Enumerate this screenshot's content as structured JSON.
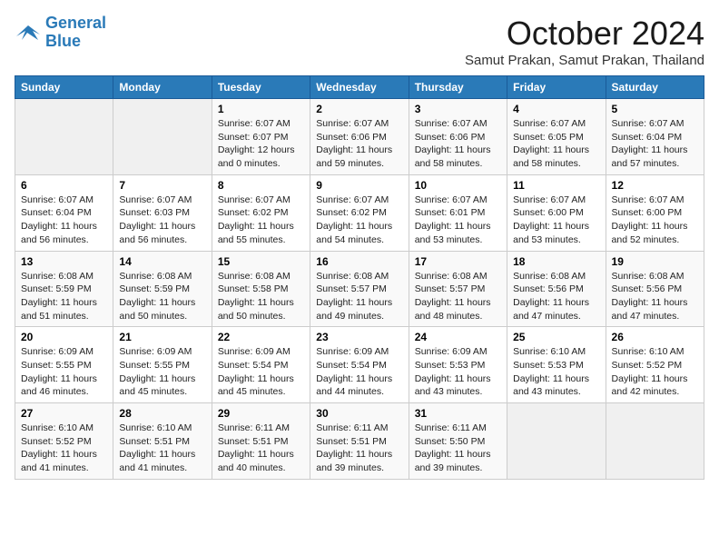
{
  "logo": {
    "line1": "General",
    "line2": "Blue"
  },
  "title": "October 2024",
  "location": "Samut Prakan, Samut Prakan, Thailand",
  "weekdays": [
    "Sunday",
    "Monday",
    "Tuesday",
    "Wednesday",
    "Thursday",
    "Friday",
    "Saturday"
  ],
  "weeks": [
    [
      {
        "day": "",
        "info": ""
      },
      {
        "day": "",
        "info": ""
      },
      {
        "day": "1",
        "info": "Sunrise: 6:07 AM\nSunset: 6:07 PM\nDaylight: 12 hours\nand 0 minutes."
      },
      {
        "day": "2",
        "info": "Sunrise: 6:07 AM\nSunset: 6:06 PM\nDaylight: 11 hours\nand 59 minutes."
      },
      {
        "day": "3",
        "info": "Sunrise: 6:07 AM\nSunset: 6:06 PM\nDaylight: 11 hours\nand 58 minutes."
      },
      {
        "day": "4",
        "info": "Sunrise: 6:07 AM\nSunset: 6:05 PM\nDaylight: 11 hours\nand 58 minutes."
      },
      {
        "day": "5",
        "info": "Sunrise: 6:07 AM\nSunset: 6:04 PM\nDaylight: 11 hours\nand 57 minutes."
      }
    ],
    [
      {
        "day": "6",
        "info": "Sunrise: 6:07 AM\nSunset: 6:04 PM\nDaylight: 11 hours\nand 56 minutes."
      },
      {
        "day": "7",
        "info": "Sunrise: 6:07 AM\nSunset: 6:03 PM\nDaylight: 11 hours\nand 56 minutes."
      },
      {
        "day": "8",
        "info": "Sunrise: 6:07 AM\nSunset: 6:02 PM\nDaylight: 11 hours\nand 55 minutes."
      },
      {
        "day": "9",
        "info": "Sunrise: 6:07 AM\nSunset: 6:02 PM\nDaylight: 11 hours\nand 54 minutes."
      },
      {
        "day": "10",
        "info": "Sunrise: 6:07 AM\nSunset: 6:01 PM\nDaylight: 11 hours\nand 53 minutes."
      },
      {
        "day": "11",
        "info": "Sunrise: 6:07 AM\nSunset: 6:00 PM\nDaylight: 11 hours\nand 53 minutes."
      },
      {
        "day": "12",
        "info": "Sunrise: 6:07 AM\nSunset: 6:00 PM\nDaylight: 11 hours\nand 52 minutes."
      }
    ],
    [
      {
        "day": "13",
        "info": "Sunrise: 6:08 AM\nSunset: 5:59 PM\nDaylight: 11 hours\nand 51 minutes."
      },
      {
        "day": "14",
        "info": "Sunrise: 6:08 AM\nSunset: 5:59 PM\nDaylight: 11 hours\nand 50 minutes."
      },
      {
        "day": "15",
        "info": "Sunrise: 6:08 AM\nSunset: 5:58 PM\nDaylight: 11 hours\nand 50 minutes."
      },
      {
        "day": "16",
        "info": "Sunrise: 6:08 AM\nSunset: 5:57 PM\nDaylight: 11 hours\nand 49 minutes."
      },
      {
        "day": "17",
        "info": "Sunrise: 6:08 AM\nSunset: 5:57 PM\nDaylight: 11 hours\nand 48 minutes."
      },
      {
        "day": "18",
        "info": "Sunrise: 6:08 AM\nSunset: 5:56 PM\nDaylight: 11 hours\nand 47 minutes."
      },
      {
        "day": "19",
        "info": "Sunrise: 6:08 AM\nSunset: 5:56 PM\nDaylight: 11 hours\nand 47 minutes."
      }
    ],
    [
      {
        "day": "20",
        "info": "Sunrise: 6:09 AM\nSunset: 5:55 PM\nDaylight: 11 hours\nand 46 minutes."
      },
      {
        "day": "21",
        "info": "Sunrise: 6:09 AM\nSunset: 5:55 PM\nDaylight: 11 hours\nand 45 minutes."
      },
      {
        "day": "22",
        "info": "Sunrise: 6:09 AM\nSunset: 5:54 PM\nDaylight: 11 hours\nand 45 minutes."
      },
      {
        "day": "23",
        "info": "Sunrise: 6:09 AM\nSunset: 5:54 PM\nDaylight: 11 hours\nand 44 minutes."
      },
      {
        "day": "24",
        "info": "Sunrise: 6:09 AM\nSunset: 5:53 PM\nDaylight: 11 hours\nand 43 minutes."
      },
      {
        "day": "25",
        "info": "Sunrise: 6:10 AM\nSunset: 5:53 PM\nDaylight: 11 hours\nand 43 minutes."
      },
      {
        "day": "26",
        "info": "Sunrise: 6:10 AM\nSunset: 5:52 PM\nDaylight: 11 hours\nand 42 minutes."
      }
    ],
    [
      {
        "day": "27",
        "info": "Sunrise: 6:10 AM\nSunset: 5:52 PM\nDaylight: 11 hours\nand 41 minutes."
      },
      {
        "day": "28",
        "info": "Sunrise: 6:10 AM\nSunset: 5:51 PM\nDaylight: 11 hours\nand 41 minutes."
      },
      {
        "day": "29",
        "info": "Sunrise: 6:11 AM\nSunset: 5:51 PM\nDaylight: 11 hours\nand 40 minutes."
      },
      {
        "day": "30",
        "info": "Sunrise: 6:11 AM\nSunset: 5:51 PM\nDaylight: 11 hours\nand 39 minutes."
      },
      {
        "day": "31",
        "info": "Sunrise: 6:11 AM\nSunset: 5:50 PM\nDaylight: 11 hours\nand 39 minutes."
      },
      {
        "day": "",
        "info": ""
      },
      {
        "day": "",
        "info": ""
      }
    ]
  ]
}
